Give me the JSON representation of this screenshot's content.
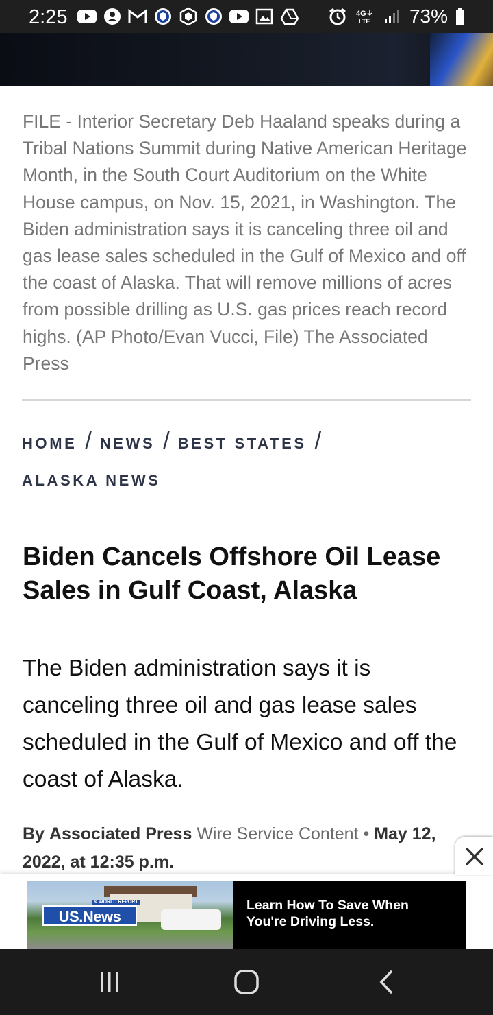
{
  "status_bar": {
    "time": "2:25",
    "battery": "73%",
    "network": "4G LTE",
    "left_icons": [
      "youtube-icon",
      "account-icon",
      "gmail-icon",
      "shield-icon",
      "crypto-icon",
      "shield-icon",
      "youtube-icon",
      "gallery-icon",
      "drive-icon"
    ],
    "right_icons": [
      "alarm-icon",
      "network-icon",
      "signal-icon",
      "battery-icon"
    ]
  },
  "article": {
    "photo_caption": "FILE - Interior Secretary Deb Haaland speaks during a Tribal Nations Summit during Native American Heritage Month, in the South Court Auditorium on the White House campus, on Nov. 15, 2021, in Washington. The Biden administration says it is canceling three oil and gas lease sales scheduled in the Gulf of Mexico and off the coast of Alaska. That will remove millions of acres from possible drilling as U.S. gas prices reach record highs. (AP Photo/Evan Vucci, File) The Associated Press",
    "breadcrumbs": [
      "HOME",
      "NEWS",
      "BEST STATES",
      "ALASKA NEWS"
    ],
    "headline": "Biden Cancels Offshore Oil Lease Sales in Gulf Coast, Alaska",
    "dek": "The Biden administration says it is canceling three oil and gas lease sales scheduled in the Gulf of Mexico and off the coast of Alaska.",
    "byline": {
      "by": "By",
      "author": "Associated Press",
      "source": "Wire Service Content",
      "separator": "•",
      "date": "May 12, 2022, at 12:35 p.m."
    }
  },
  "ad": {
    "logo": "US.News",
    "logo_sub": "& WORLD REPORT",
    "text": "Learn How To Save When You're Driving Less.",
    "close_icon": "close-icon"
  },
  "nav_bar": {
    "icons": [
      "recent-apps-icon",
      "home-icon",
      "back-icon"
    ]
  }
}
